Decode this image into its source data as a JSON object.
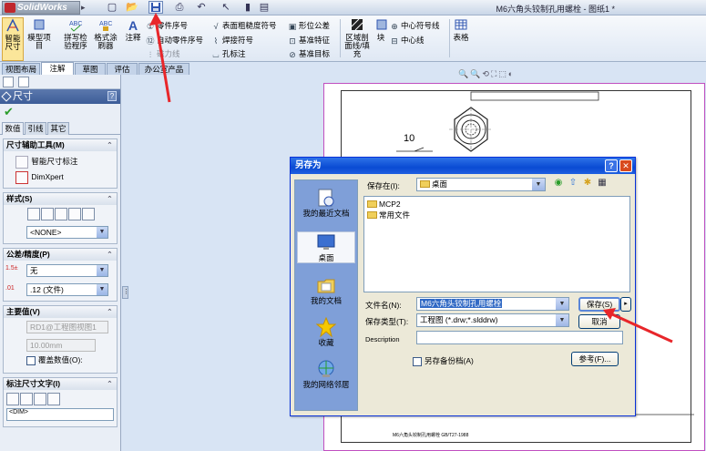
{
  "app": {
    "logo": "SolidWorks",
    "window_title": "M6六角头铰制孔用螺栓 - 图纸1 *"
  },
  "colors": {
    "accent_red": "#e8262a",
    "dialog_title": "#0a4bd3",
    "panel_title": "#3c5c98"
  },
  "quick_access": {
    "icons": [
      "new-icon",
      "open-icon",
      "save-icon",
      "print-icon",
      "undo-icon",
      "select-icon",
      "rebuild-icon",
      "options-icon"
    ]
  },
  "ribbon": {
    "smart_dimension": "智能尺寸",
    "model_items": "模型项目",
    "spell_checker": "拼写检验程序",
    "format_painter": "格式涂刷器",
    "note": "注释",
    "balloon": "零件序号",
    "auto_balloon": "自动零件序号",
    "magnetic_line": "磁力线",
    "surface_finish": "表面粗糙度符号",
    "weld_symbol": "焊接符号",
    "hole_callout": "孔标注",
    "geometric_tolerance": "形位公差",
    "datum_feature": "基准特征",
    "datum_target": "基准目标",
    "area_hatch": "区域剖面线/填充",
    "block": "块",
    "center_mark": "中心符号线",
    "centerline": "中心线",
    "table": "表格"
  },
  "tabs": [
    "视图布局",
    "注解",
    "草图",
    "评估",
    "办公室产品"
  ],
  "active_tab": "注解",
  "property_manager": {
    "title": "尺寸",
    "help": "?",
    "subtabs": [
      "数值",
      "引线",
      "其它"
    ],
    "groups": {
      "dim_assist": {
        "title": "尺寸辅助工具(M)",
        "items": [
          "智能尺寸标注",
          "DimXpert"
        ]
      },
      "style": {
        "title": "样式(S)",
        "value": "<NONE>"
      },
      "tolerance": {
        "title": "公差/精度(P)",
        "tolerance_type": "无",
        "precision": ".12 (文件)"
      },
      "primary": {
        "title": "主要值(V)",
        "reference": "RD1@工程图视图1",
        "value": "10.00mm",
        "override_label": "覆盖数值(O):"
      },
      "dim_text": {
        "title": "标注尺寸文字(I)",
        "text": "<DIM>"
      }
    }
  },
  "drawing": {
    "dimension_label": "10",
    "title_block_text": "M6六角头铰制孔用螺栓 GB/T27-1988"
  },
  "dialog": {
    "title": "另存为",
    "save_in_label": "保存在(I):",
    "save_in_value": "桌面",
    "places": [
      "我的最近文档",
      "桌面",
      "我的文档",
      "收藏",
      "我的网络邻居"
    ],
    "files": [
      "MCP2",
      "常用文件"
    ],
    "filename_label": "文件名(N):",
    "filename_value": "M6六角头铰制孔用螺栓",
    "filetype_label": "保存类型(T):",
    "filetype_value": "工程图 (*.drw;*.slddrw)",
    "description_label": "Description",
    "description_value": "",
    "save_copy_label": "另存备份档(A)",
    "save_button": "保存(S)",
    "cancel_button": "取消",
    "references_button": "参考(F)...",
    "help_glyph": "?",
    "close_glyph": "✕"
  }
}
